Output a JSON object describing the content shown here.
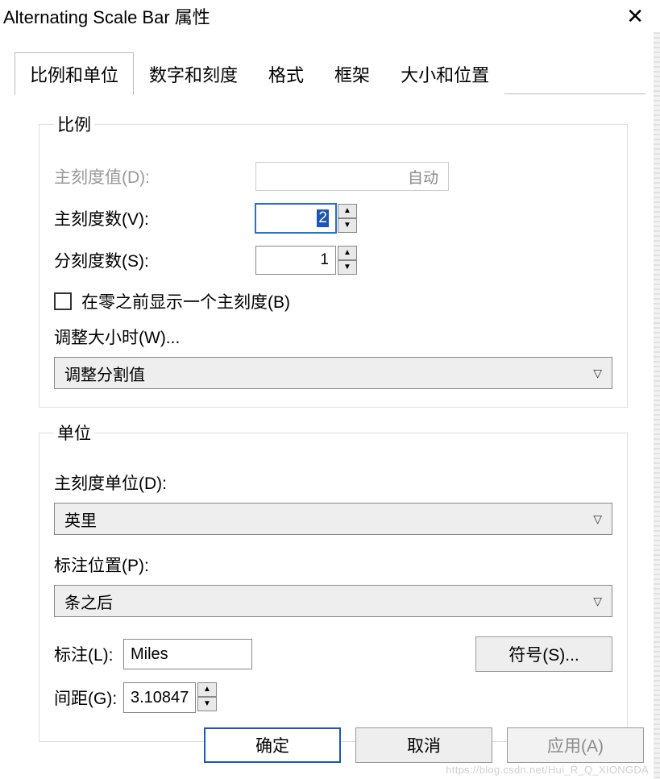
{
  "title": "Alternating Scale Bar 属性",
  "tabs": [
    {
      "label": "比例和单位",
      "active": true
    },
    {
      "label": "数字和刻度",
      "active": false
    },
    {
      "label": "格式",
      "active": false
    },
    {
      "label": "框架",
      "active": false
    },
    {
      "label": "大小和位置",
      "active": false
    }
  ],
  "scale_group": {
    "legend": "比例",
    "division_value_label": "主刻度值(D):",
    "division_value_placeholder": "自动",
    "num_divisions_label": "主刻度数(V):",
    "num_divisions_value": "2",
    "num_subdivisions_label": "分刻度数(S):",
    "num_subdivisions_value": "1",
    "checkbox_label": "在零之前显示一个主刻度(B)",
    "resize_label": "调整大小时(W)...",
    "resize_value": "调整分割值"
  },
  "units_group": {
    "legend": "单位",
    "division_units_label": "主刻度单位(D):",
    "division_units_value": "英里",
    "label_position_label": "标注位置(P):",
    "label_position_value": "条之后",
    "label_field_label": "标注(L):",
    "label_field_value": "Miles",
    "symbol_button_label": "符号(S)...",
    "gap_label": "间距(G):",
    "gap_value": "3.10847"
  },
  "footer": {
    "ok": "确定",
    "cancel": "取消",
    "apply": "应用(A)"
  },
  "watermark": "https://blog.csdn.net/Hui_R_Q_XIONGDA"
}
